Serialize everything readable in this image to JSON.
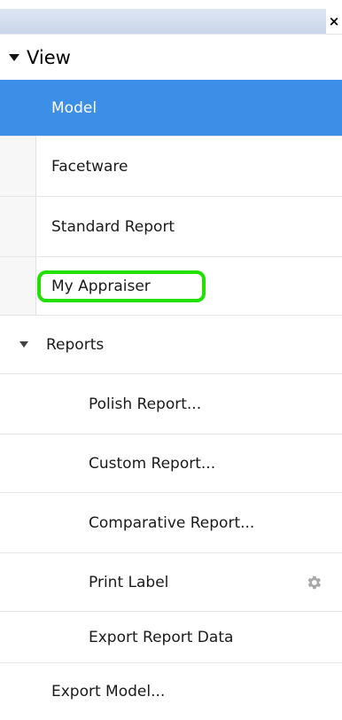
{
  "panel": {
    "close_glyph": "×"
  },
  "view": {
    "label": "View"
  },
  "items": [
    {
      "label": "Model",
      "selected": true
    },
    {
      "label": "Facetware"
    },
    {
      "label": "Standard Report"
    },
    {
      "label": "My Appraiser",
      "highlighted": true
    }
  ],
  "reports": {
    "label": "Reports",
    "items": [
      {
        "label": "Polish Report..."
      },
      {
        "label": "Custom Report..."
      },
      {
        "label": "Comparative Report..."
      },
      {
        "label": "Print Label",
        "icon": "gear-icon"
      },
      {
        "label": "Export Report Data"
      }
    ]
  },
  "export_model": {
    "label": "Export Model..."
  },
  "colors": {
    "selected_bg": "#3d8ee6",
    "highlight_border": "#22e000"
  }
}
